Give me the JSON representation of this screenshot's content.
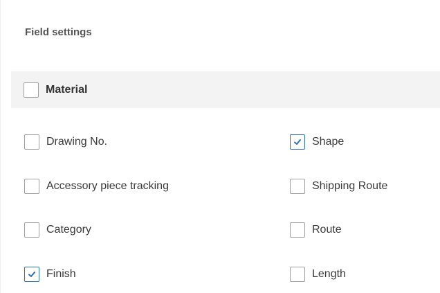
{
  "panel": {
    "title": "Field settings"
  },
  "group": {
    "label": "Material",
    "checked": false
  },
  "fields": [
    {
      "label": "Drawing No.",
      "checked": false
    },
    {
      "label": "Shape",
      "checked": true
    },
    {
      "label": "Accessory piece tracking",
      "checked": false
    },
    {
      "label": "Shipping Route",
      "checked": false
    },
    {
      "label": "Category",
      "checked": false
    },
    {
      "label": "Route",
      "checked": false
    },
    {
      "label": "Finish",
      "checked": true
    },
    {
      "label": "Length",
      "checked": false
    }
  ],
  "colors": {
    "accent": "#2b6fb8",
    "checkbox_border": "#9e9e9e",
    "group_background": "#f3f3f3"
  },
  "icons": {
    "checkbox_checked": "check-icon"
  }
}
